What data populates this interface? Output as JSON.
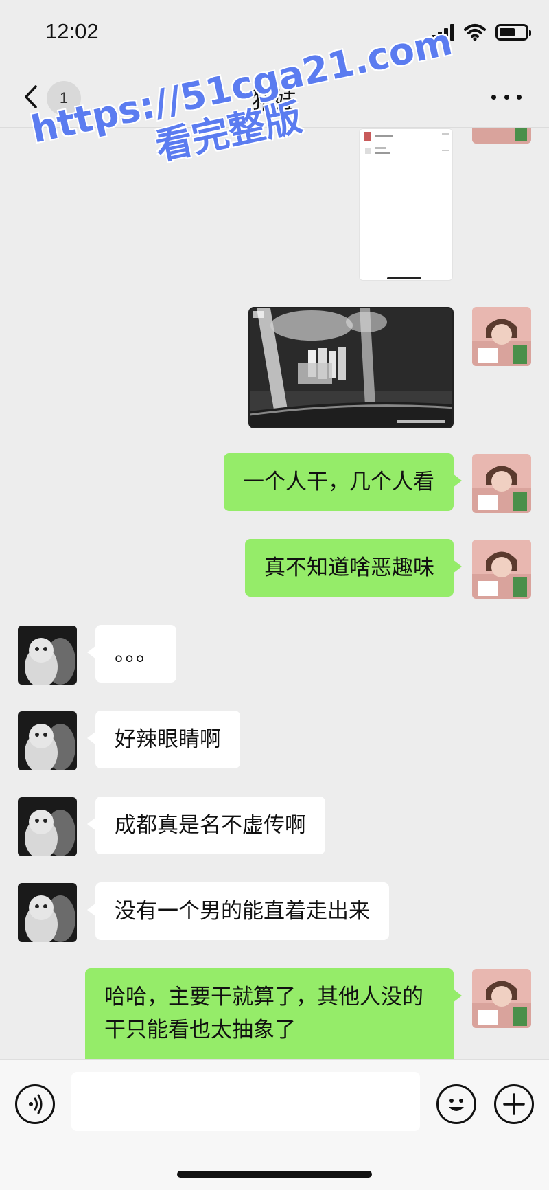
{
  "status_bar": {
    "time": "12:02",
    "battery_level": 0.6
  },
  "nav": {
    "unread_count": "1",
    "title": "猪娃",
    "icons": [
      "chevron-left-icon",
      "more-icon"
    ]
  },
  "messages": [
    {
      "from": "me",
      "type": "image",
      "kind": "chat-screenshot"
    },
    {
      "from": "me",
      "type": "image",
      "kind": "night-camera-photo"
    },
    {
      "from": "me",
      "type": "text",
      "text": "一个人干，几个人看"
    },
    {
      "from": "me",
      "type": "text",
      "text": "真不知道啥恶趣味"
    },
    {
      "from": "them",
      "type": "text",
      "text": "。。。"
    },
    {
      "from": "them",
      "type": "text",
      "text": "好辣眼睛啊"
    },
    {
      "from": "them",
      "type": "text",
      "text": "成都真是名不虚传啊"
    },
    {
      "from": "them",
      "type": "text",
      "text": "没有一个男的能直着走出来"
    },
    {
      "from": "me",
      "type": "text",
      "text": "哈哈，主要干就算了，其他人没的干只能看也太抽象了"
    }
  ],
  "watermark": {
    "line1": "https://51cga21.com",
    "line2": "看完整版",
    "color": "#5b7cf0"
  },
  "input_bar": {
    "value": "",
    "icons": [
      "voice-icon",
      "emoji-icon",
      "plus-icon"
    ]
  },
  "colors": {
    "background": "#ededed",
    "my_bubble": "#95ec69",
    "their_bubble": "#ffffff"
  }
}
